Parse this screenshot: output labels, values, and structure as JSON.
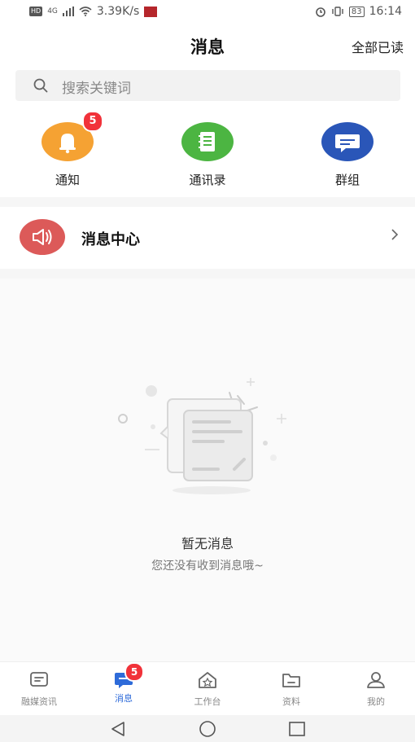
{
  "status_bar": {
    "network": "4G",
    "speed": "3.39K/s",
    "battery": "83",
    "time": "16:14"
  },
  "header": {
    "title": "消息",
    "read_all": "全部已读"
  },
  "search": {
    "placeholder": "搜索关键词"
  },
  "quick_actions": [
    {
      "label": "通知",
      "icon": "bell-icon",
      "color": "#f5a233",
      "badge": "5"
    },
    {
      "label": "通讯录",
      "icon": "address-book-icon",
      "color": "#4cb542"
    },
    {
      "label": "群组",
      "icon": "chat-bubble-icon",
      "color": "#2a56b8"
    }
  ],
  "message_center": {
    "label": "消息中心",
    "icon": "speaker-icon",
    "color": "#dc5a59"
  },
  "empty_state": {
    "title": "暂无消息",
    "subtitle": "您还没有收到消息哦~"
  },
  "bottom_nav": [
    {
      "label": "融媒资讯",
      "icon": "news-icon"
    },
    {
      "label": "消息",
      "icon": "message-icon",
      "badge": "5",
      "active": true
    },
    {
      "label": "工作台",
      "icon": "workbench-icon"
    },
    {
      "label": "资料",
      "icon": "folder-icon"
    },
    {
      "label": "我的",
      "icon": "profile-icon"
    }
  ],
  "colors": {
    "accent": "#2e6bd9",
    "badge": "#f1323a"
  }
}
